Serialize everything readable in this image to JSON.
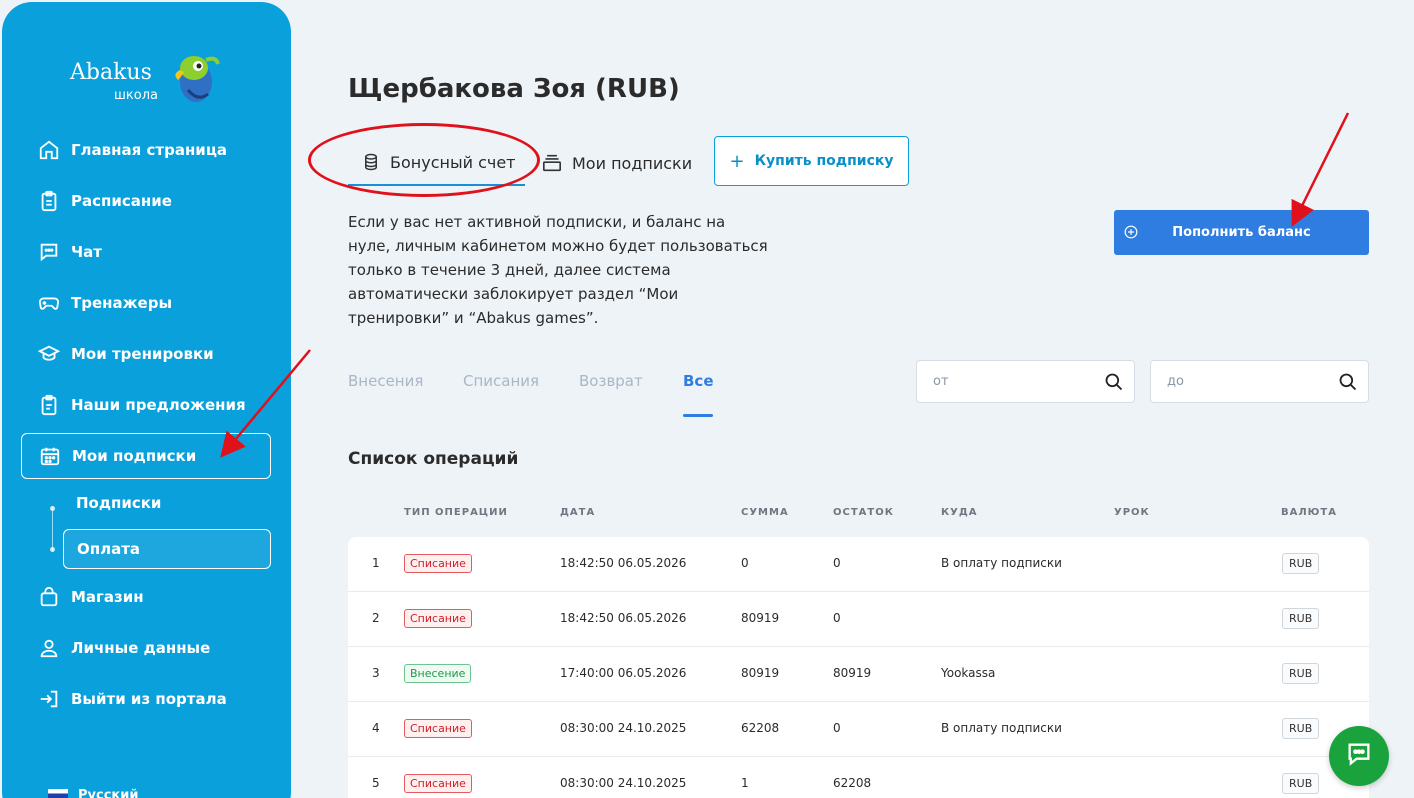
{
  "logo": {
    "word": "Abakus",
    "sub": "школа"
  },
  "sidebar": {
    "items": [
      {
        "label": "Главная страница",
        "icon": "home-icon"
      },
      {
        "label": "Расписание",
        "icon": "clipboard-icon"
      },
      {
        "label": "Чат",
        "icon": "chat-icon"
      },
      {
        "label": "Тренажеры",
        "icon": "gamepad-icon"
      },
      {
        "label": "Мои тренировки",
        "icon": "graduation-cap-icon"
      },
      {
        "label": "Наши предложения",
        "icon": "clipboard-list-icon"
      },
      {
        "label": "Мои подписки",
        "icon": "calendar-icon"
      },
      {
        "label": "Магазин",
        "icon": "shopping-bag-icon"
      },
      {
        "label": "Личные данные",
        "icon": "user-icon"
      },
      {
        "label": "Выйти из портала",
        "icon": "logout-icon"
      }
    ],
    "subitems": [
      {
        "label": "Подписки"
      },
      {
        "label": "Оплата"
      }
    ],
    "language": "Русский"
  },
  "page": {
    "title": "Щербакова Зоя (RUB)",
    "tabs": [
      {
        "label": "Бонусный счет"
      },
      {
        "label": "Мои подписки"
      }
    ],
    "buy_label": "Купить подписку",
    "info": "Если у вас нет активной подписки, и баланс на нуле, личным кабинетом можно будет пользоваться только в течение 3 дней, далее система автоматически заблокирует раздел “Мои тренировки” и “Abakus games”.",
    "topup_label": "Пополнить баланс",
    "filter_tabs": [
      "Внесения",
      "Списания",
      "Возврат",
      "Все"
    ],
    "from_placeholder": "от",
    "to_placeholder": "до",
    "list_title": "Список операций"
  },
  "table": {
    "headers": [
      "ТИП ОПЕРАЦИИ",
      "ДАТА",
      "СУММА",
      "ОСТАТОК",
      "КУДА",
      "УРОК",
      "ВАЛЮТА"
    ],
    "rows": [
      {
        "n": "1",
        "type": "Списание",
        "date": "18:42:50 06.05.2026",
        "sum": "0",
        "rest": "0",
        "to": "В оплату подписки",
        "lesson": "",
        "cur": "RUB"
      },
      {
        "n": "2",
        "type": "Списание",
        "date": "18:42:50 06.05.2026",
        "sum": "80919",
        "rest": "0",
        "to": "",
        "lesson": "",
        "cur": "RUB"
      },
      {
        "n": "3",
        "type": "Внесение",
        "date": "17:40:00 06.05.2026",
        "sum": "80919",
        "rest": "80919",
        "to": "Yookassa",
        "lesson": "",
        "cur": "RUB"
      },
      {
        "n": "4",
        "type": "Списание",
        "date": "08:30:00 24.10.2025",
        "sum": "62208",
        "rest": "0",
        "to": "В оплату подписки",
        "lesson": "",
        "cur": "RUB"
      },
      {
        "n": "5",
        "type": "Списание",
        "date": "08:30:00 24.10.2025",
        "sum": "1",
        "rest": "62208",
        "to": "",
        "lesson": "",
        "cur": "RUB"
      }
    ]
  },
  "colors": {
    "sidebar": "#0aa0dc",
    "primary": "#2f7de1",
    "annotation": "#e0111b",
    "chat": "#1aa33c"
  }
}
